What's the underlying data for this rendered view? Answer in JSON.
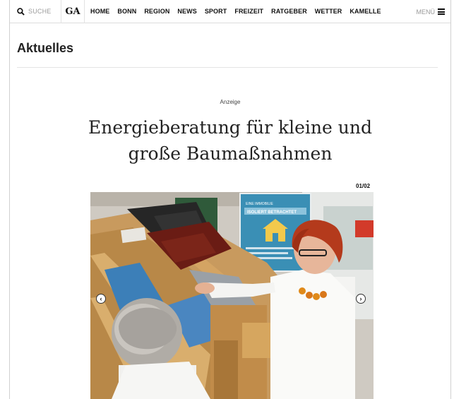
{
  "header": {
    "search_label": "SUCHE",
    "logo": "GA",
    "nav": [
      "HOME",
      "BONN",
      "REGION",
      "NEWS",
      "SPORT",
      "FREIZEIT",
      "RATGEBER",
      "WETTER",
      "KAMELLE"
    ],
    "menu_label": "MENÜ"
  },
  "section": {
    "title": "Aktuelles"
  },
  "article": {
    "ad_label": "Anzeige",
    "headline_line1": "Energieberatung für kleine und",
    "headline_line2": "große Baumaßnahmen"
  },
  "gallery": {
    "counter": "01/02",
    "poster_text_1": "EINE IMMOBILIE",
    "poster_text_2": "ISOLIERT BETRACHTET"
  },
  "colors": {
    "accent_poster": "#3a8fb5",
    "roof_tile_red": "#6a1c14",
    "roof_tile_dark": "#262626"
  }
}
